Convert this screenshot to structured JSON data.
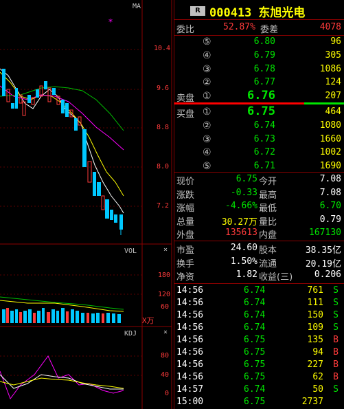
{
  "stock": {
    "badge": "R",
    "code": "000413",
    "name": "东旭光电"
  },
  "chart": {
    "main_label": "MA",
    "main_ticks": [
      "10.4",
      "9.6",
      "8.8",
      "8.0",
      "7.2"
    ],
    "vol_label": "VOL",
    "vol_ticks": [
      "180",
      "120",
      "60"
    ],
    "vol_unit": "X万",
    "kdj_label": "KDJ",
    "kdj_ticks": [
      "80",
      "40",
      "0"
    ]
  },
  "order_ratio": {
    "label1": "委比",
    "value1": "52.87%",
    "label2": "委差",
    "value2": "4078"
  },
  "sell": [
    {
      "level": "⑤",
      "price": "6.80",
      "volume": "96"
    },
    {
      "level": "④",
      "price": "6.79",
      "volume": "305"
    },
    {
      "level": "③",
      "price": "6.78",
      "volume": "1086"
    },
    {
      "level": "②",
      "price": "6.77",
      "volume": "124"
    },
    {
      "level": "①",
      "price": "6.76",
      "volume": "207",
      "label": "卖盘"
    }
  ],
  "buy": [
    {
      "level": "①",
      "price": "6.75",
      "volume": "464",
      "label": "买盘"
    },
    {
      "level": "②",
      "price": "6.74",
      "volume": "1080"
    },
    {
      "level": "③",
      "price": "6.73",
      "volume": "1660"
    },
    {
      "level": "④",
      "price": "6.72",
      "volume": "1002"
    },
    {
      "level": "⑤",
      "price": "6.71",
      "volume": "1690"
    }
  ],
  "quote": [
    {
      "l1": "现价",
      "v1": "6.75",
      "l2": "今开",
      "v2": "7.08"
    },
    {
      "l1": "涨跌",
      "v1": "-0.33",
      "l2": "最高",
      "v2": "7.08"
    },
    {
      "l1": "涨幅",
      "v1": "-4.66%",
      "l2": "最低",
      "v2": "6.70"
    },
    {
      "l1": "总量",
      "v1": "30.27万",
      "l2": "量比",
      "v2": "0.79"
    },
    {
      "l1": "外盘",
      "v1": "135613",
      "l2": "内盘",
      "v2": "167130"
    }
  ],
  "fundamentals": [
    {
      "l1": "市盈",
      "v1": "24.60",
      "l2": "股本",
      "v2": "38.35亿"
    },
    {
      "l1": "换手",
      "v1": "1.50%",
      "l2": "流通",
      "v2": "20.19亿"
    },
    {
      "l1": "净资",
      "v1": "1.82",
      "l2": "收益(三)",
      "v2": "0.206"
    }
  ],
  "ticks": [
    {
      "time": "14:56",
      "price": "6.74",
      "vol": "761",
      "side": "S"
    },
    {
      "time": "14:56",
      "price": "6.74",
      "vol": "111",
      "side": "S"
    },
    {
      "time": "14:56",
      "price": "6.74",
      "vol": "150",
      "side": "S"
    },
    {
      "time": "14:56",
      "price": "6.74",
      "vol": "109",
      "side": "S"
    },
    {
      "time": "14:56",
      "price": "6.75",
      "vol": "135",
      "side": "B"
    },
    {
      "time": "14:56",
      "price": "6.75",
      "vol": "94",
      "side": "B"
    },
    {
      "time": "14:56",
      "price": "6.75",
      "vol": "227",
      "side": "B"
    },
    {
      "time": "14:56",
      "price": "6.75",
      "vol": "62",
      "side": "B"
    },
    {
      "time": "14:57",
      "price": "6.74",
      "vol": "50",
      "side": "S"
    },
    {
      "time": "15:00",
      "price": "6.75",
      "vol": "2737",
      "side": ""
    }
  ],
  "colors": {
    "up": "#ff3b3b",
    "down": "#00e600",
    "grid": "#8b0000",
    "candle_down": "#00c8ff"
  }
}
